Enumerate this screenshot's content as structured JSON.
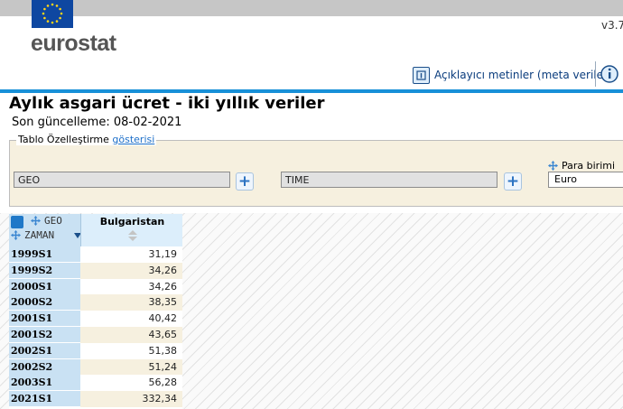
{
  "header": {
    "logo_text": "eurostat",
    "version": "v3.7",
    "metadata_label": "Açıklayıcı metinler (meta veriler)"
  },
  "page": {
    "title": "Aylık asgari ücret - iki yıllık veriler",
    "last_update": "Son güncelleme: 08-02-2021"
  },
  "customization": {
    "legend_label": "Tablo Özelleştirme",
    "show_link": "gösterisi",
    "dim_geo": "GEO",
    "dim_time": "TIME",
    "unit_label": "Para birimi",
    "unit_value": "Euro"
  },
  "table": {
    "corner_geo": "GEO",
    "corner_time": "ZAMAN",
    "column_header": "Bulgaristan",
    "rows": [
      {
        "period": "1999S1",
        "value": "31,19"
      },
      {
        "period": "1999S2",
        "value": "34,26"
      },
      {
        "period": "2000S1",
        "value": "34,26"
      },
      {
        "period": "2000S2",
        "value": "38,35"
      },
      {
        "period": "2001S1",
        "value": "40,42"
      },
      {
        "period": "2001S2",
        "value": "43,65"
      },
      {
        "period": "2002S1",
        "value": "51,38"
      },
      {
        "period": "2002S2",
        "value": "51,24"
      },
      {
        "period": "2003S1",
        "value": "56,28"
      },
      {
        "period": "2021S1",
        "value": "332,34"
      }
    ]
  },
  "colors": {
    "accent_blue": "#1790d8",
    "eu_blue": "#0e47a1",
    "header_cell": "#c9e1f3",
    "panel_beige": "#f6f0df"
  }
}
